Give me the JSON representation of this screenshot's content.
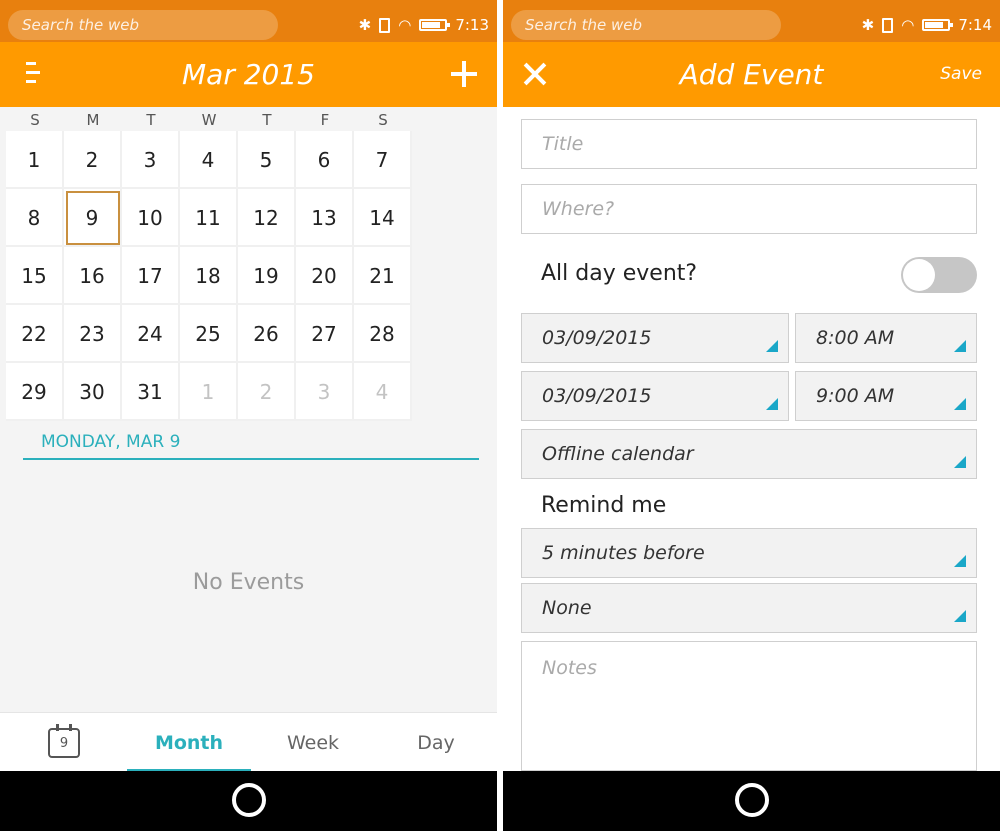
{
  "left": {
    "status": {
      "search_placeholder": "Search the web",
      "time": "7:13"
    },
    "header": {
      "title": "Mar 2015"
    },
    "weekdays": [
      "S",
      "M",
      "T",
      "W",
      "T",
      "F",
      "S"
    ],
    "days": [
      {
        "label": "1",
        "muted": false
      },
      {
        "label": "2",
        "muted": false
      },
      {
        "label": "3",
        "muted": false
      },
      {
        "label": "4",
        "muted": false
      },
      {
        "label": "5",
        "muted": false
      },
      {
        "label": "6",
        "muted": false
      },
      {
        "label": "7",
        "muted": false
      },
      {
        "label": "8",
        "muted": false
      },
      {
        "label": "9",
        "muted": false,
        "selected": true
      },
      {
        "label": "10",
        "muted": false
      },
      {
        "label": "11",
        "muted": false
      },
      {
        "label": "12",
        "muted": false
      },
      {
        "label": "13",
        "muted": false
      },
      {
        "label": "14",
        "muted": false
      },
      {
        "label": "15",
        "muted": false
      },
      {
        "label": "16",
        "muted": false
      },
      {
        "label": "17",
        "muted": false
      },
      {
        "label": "18",
        "muted": false
      },
      {
        "label": "19",
        "muted": false
      },
      {
        "label": "20",
        "muted": false
      },
      {
        "label": "21",
        "muted": false
      },
      {
        "label": "22",
        "muted": false
      },
      {
        "label": "23",
        "muted": false
      },
      {
        "label": "24",
        "muted": false
      },
      {
        "label": "25",
        "muted": false
      },
      {
        "label": "26",
        "muted": false
      },
      {
        "label": "27",
        "muted": false
      },
      {
        "label": "28",
        "muted": false
      },
      {
        "label": "29",
        "muted": false
      },
      {
        "label": "30",
        "muted": false
      },
      {
        "label": "31",
        "muted": false
      },
      {
        "label": "1",
        "muted": true
      },
      {
        "label": "2",
        "muted": true
      },
      {
        "label": "3",
        "muted": true
      },
      {
        "label": "4",
        "muted": true
      }
    ],
    "day_heading": "MONDAY, MAR 9",
    "no_events": "No Events",
    "tabs": {
      "today_icon_number": "9",
      "month": "Month",
      "week": "Week",
      "day": "Day"
    }
  },
  "right": {
    "status": {
      "search_placeholder": "Search the web",
      "time": "7:14"
    },
    "header": {
      "title": "Add Event",
      "save_label": "Save"
    },
    "form": {
      "title_placeholder": "Title",
      "where_placeholder": "Where?",
      "all_day_label": "All day event?",
      "all_day_on": false,
      "start_date": "03/09/2015",
      "start_time": "8:00 AM",
      "end_date": "03/09/2015",
      "end_time": "9:00 AM",
      "calendar": "Offline calendar",
      "remind_label": "Remind me",
      "reminder_1": "5 minutes before",
      "reminder_2": "None",
      "notes_placeholder": "Notes"
    }
  },
  "colors": {
    "status_bar": "#e8800e",
    "header": "#ff9a00",
    "accent": "#2bb0bc",
    "selected_day_border": "#c9903f"
  }
}
